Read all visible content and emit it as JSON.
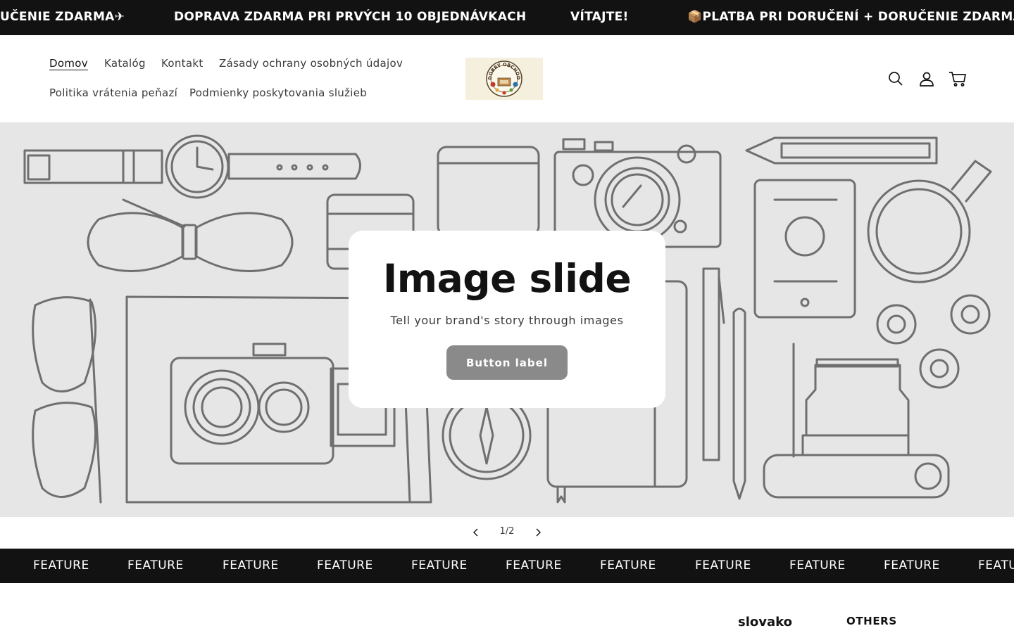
{
  "announcement": {
    "items": [
      "UČENIE ZDARMA✈",
      "DOPRAVA ZDARMA PRI PRVÝCH 10 OBJEDNÁVKACH",
      "VÍTAJTE!",
      "📦PLATBA PRI DORUČENÍ + DORUČENIE ZDARMA✈"
    ]
  },
  "header": {
    "nav": [
      "Domov",
      "Katalóg",
      "Kontakt",
      "Zásady ochrany osobných údajov",
      "Politika vrátenia peňazí",
      "Podmienky poskytovania služieb"
    ],
    "active_nav": "Domov",
    "logo_text": "DOBRÝ OBCHOD",
    "icons": [
      "search-icon",
      "account-icon",
      "cart-icon"
    ]
  },
  "hero": {
    "title": "Image slide",
    "subtitle": "Tell your brand's story through images",
    "button_label": "Button label",
    "counter": "1/2"
  },
  "features": {
    "items": [
      "FEATURE",
      "FEATURE",
      "FEATURE",
      "FEATURE",
      "FEATURE",
      "FEATURE",
      "FEATURE",
      "FEATURE",
      "FEATURE",
      "FEATURE",
      "FEATU"
    ]
  },
  "footer": {
    "col1_heading": "slovako",
    "col2_heading": "OTHERS"
  },
  "colors": {
    "bar_background": "#121212",
    "hero_background": "#e6e6e6",
    "button_background": "#8a8a8a",
    "illustration_stroke": "#6f6f6f",
    "text": "#121212"
  }
}
